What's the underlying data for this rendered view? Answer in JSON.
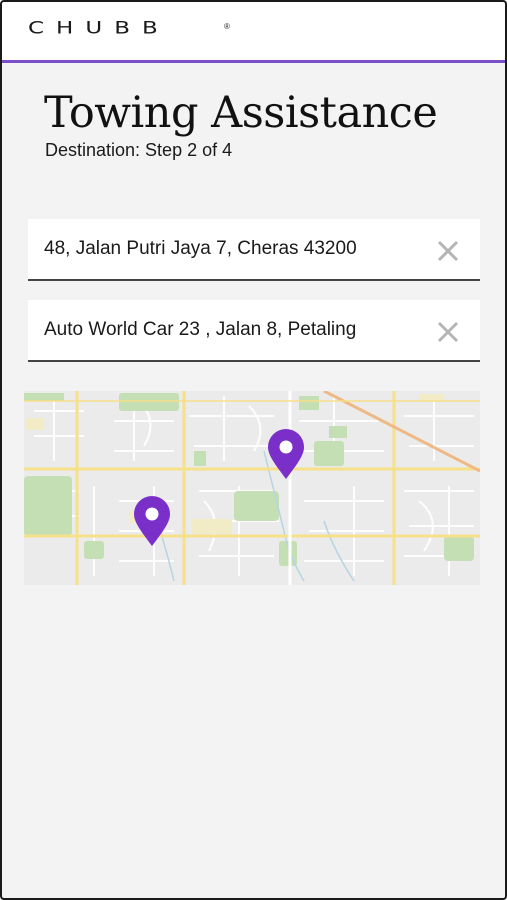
{
  "header": {
    "logo_text": "CHUBB",
    "logo_mark": "®"
  },
  "page": {
    "title": "Towing Assistance",
    "subtitle": "Destination: Step 2 of 4"
  },
  "fields": {
    "origin": {
      "value": "48, Jalan Putri Jaya 7, Cheras 43200",
      "clear_icon": "close-icon"
    },
    "destination": {
      "value": "Auto World Car 23 , Jalan 8, Petaling",
      "clear_icon": "close-icon"
    }
  },
  "map": {
    "pin_color": "#7a2fc9",
    "pins": [
      "origin-pin",
      "destination-pin"
    ]
  },
  "colors": {
    "accent": "#7b4fc9",
    "background": "#f3f3f3"
  }
}
